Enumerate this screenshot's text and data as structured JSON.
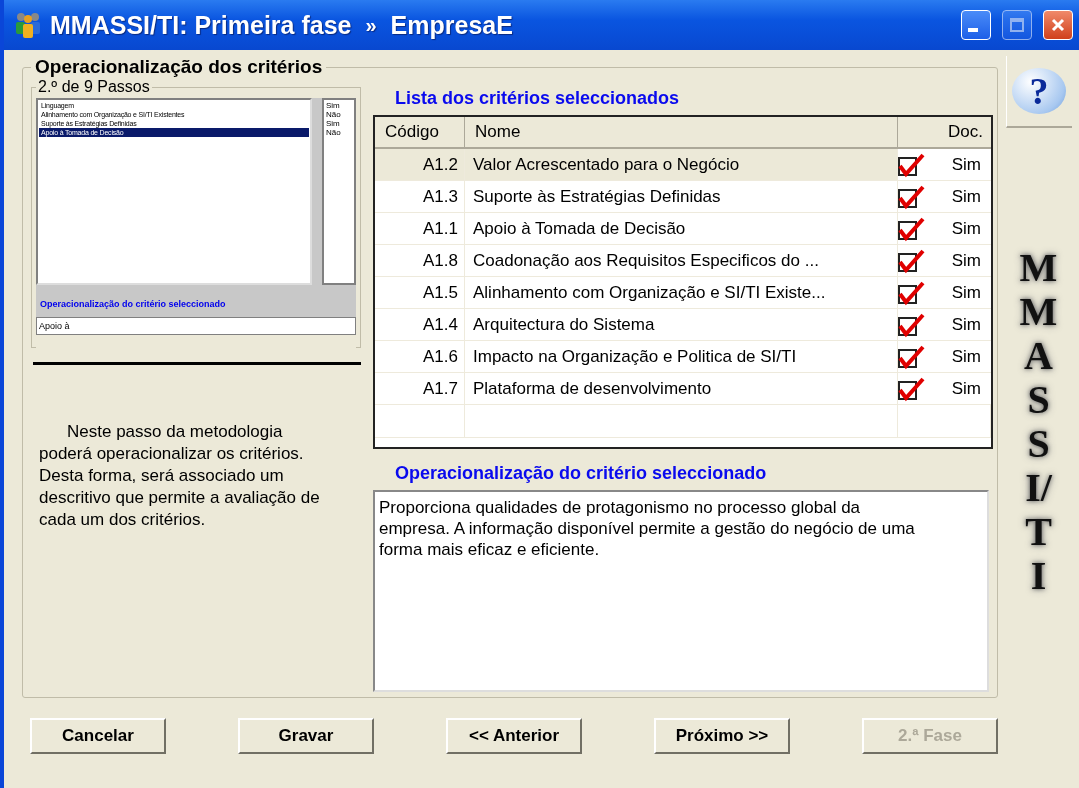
{
  "window": {
    "title": "MMASSI/TI: Primeira fase",
    "separator": "»",
    "subtitle": "EmpresaE",
    "controls": [
      {
        "kind": "minimize",
        "disabled": false
      },
      {
        "kind": "maximize",
        "disabled": true
      },
      {
        "kind": "close",
        "disabled": false
      }
    ]
  },
  "group": {
    "title": "Operacionalização dos critérios"
  },
  "steps": {
    "title": "2.º de 9 Passos",
    "preview": {
      "items": [
        {
          "label": "Linguagem",
          "value": "Sim",
          "selected": false
        },
        {
          "label": "Alinhamento com Organização e SI/TI Existentes",
          "value": "Não",
          "selected": false
        },
        {
          "label": "Suporte às Estratégias Definidas",
          "value": "Sim",
          "selected": false
        },
        {
          "label": "Apoio à Tomada de Decisão",
          "value": "Não",
          "selected": true
        }
      ],
      "caption": "Operacionalização do critério seleccionado",
      "field_value": "Apoio à"
    }
  },
  "description": "Neste passo da metodologia poderá operacionalizar os critérios.  Desta forma, será associado um descritivo que permite a avaliação de cada um dos critérios.",
  "criteria": {
    "title": "Lista dos critérios seleccionados",
    "columns": [
      "Código",
      "Nome",
      "Doc."
    ],
    "rows": [
      {
        "code": "A1.2",
        "name": "Valor Acrescentado para o Negócio",
        "checked": true,
        "doc": "Sim",
        "selected": true
      },
      {
        "code": "A1.3",
        "name": "Suporte às Estratégias Definidas",
        "checked": true,
        "doc": "Sim",
        "selected": false
      },
      {
        "code": "A1.1",
        "name": "Apoio à Tomada de Decisão",
        "checked": true,
        "doc": "Sim",
        "selected": false
      },
      {
        "code": "A1.8",
        "name": "Coadonação aos Requisitos Especificos do ...",
        "checked": true,
        "doc": "Sim",
        "selected": false
      },
      {
        "code": "A1.5",
        "name": "Alinhamento com Organização e SI/TI Existe...",
        "checked": true,
        "doc": "Sim",
        "selected": false
      },
      {
        "code": "A1.4",
        "name": "Arquitectura do Sistema",
        "checked": true,
        "doc": "Sim",
        "selected": false
      },
      {
        "code": "A1.6",
        "name": "Impacto na Organização e Politica de SI/TI",
        "checked": true,
        "doc": "Sim",
        "selected": false
      },
      {
        "code": "A1.7",
        "name": "Plataforma de desenvolvimento",
        "checked": true,
        "doc": "Sim",
        "selected": false
      }
    ]
  },
  "detail": {
    "title": "Operacionalização do critério seleccionado",
    "text": "Proporciona qualidades de protagonismo no processo global da empresa. A informação disponível permite a gestão do negócio de uma forma mais eficaz e eficiente."
  },
  "help_button": {
    "label": "?"
  },
  "logo": {
    "text": "MMASSI/TI"
  },
  "buttons": [
    {
      "label": "Cancelar",
      "disabled": false
    },
    {
      "label": "Gravar",
      "disabled": false
    },
    {
      "label": "<< Anterior",
      "disabled": false
    },
    {
      "label": "Próximo >>",
      "disabled": false
    },
    {
      "label": "2.ª Fase",
      "disabled": true
    }
  ]
}
